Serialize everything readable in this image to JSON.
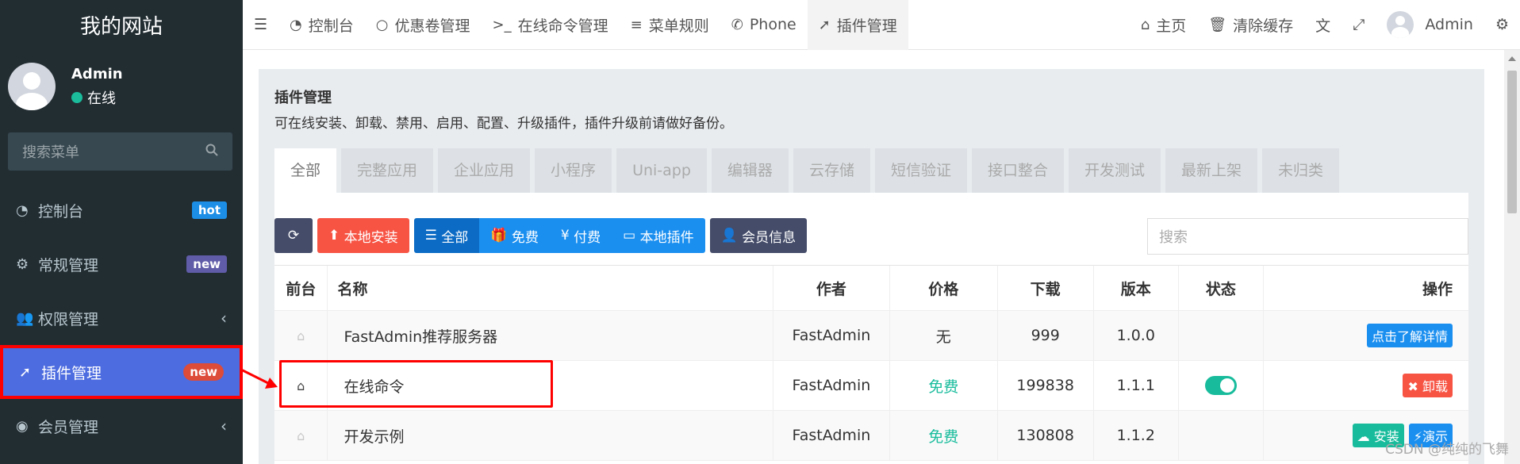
{
  "sidebar": {
    "site_title": "我的网站",
    "user_name": "Admin",
    "user_status": "在线",
    "search_placeholder": "搜索菜单",
    "items": [
      {
        "label": "控制台",
        "badge": "hot",
        "icon": "dashboard-icon"
      },
      {
        "label": "常规管理",
        "badge": "new",
        "icon": "cogs-icon"
      },
      {
        "label": "权限管理",
        "icon": "users-icon"
      },
      {
        "label": "插件管理",
        "badge": "new",
        "icon": "rocket-icon"
      },
      {
        "label": "会员管理",
        "icon": "user-circle-icon"
      }
    ]
  },
  "topbar": {
    "tabs": [
      {
        "label": "控制台",
        "icon": "dashboard-icon"
      },
      {
        "label": "优惠卷管理",
        "icon": "circle-icon"
      },
      {
        "label": "在线命令管理",
        "icon": "terminal-icon"
      },
      {
        "label": "菜单规则",
        "icon": "list-icon"
      },
      {
        "label": "Phone",
        "icon": "phone-icon"
      },
      {
        "label": "插件管理",
        "icon": "rocket-icon"
      }
    ],
    "home_label": "主页",
    "clear_cache_label": "清除缓存",
    "user_label": "Admin"
  },
  "panel": {
    "title": "插件管理",
    "description": "可在线安装、卸载、禁用、启用、配置、升级插件，插件升级前请做好备份。",
    "category_tabs": [
      "全部",
      "完整应用",
      "企业应用",
      "小程序",
      "Uni-app",
      "编辑器",
      "云存储",
      "短信验证",
      "接口整合",
      "开发测试",
      "最新上架",
      "未归类"
    ]
  },
  "toolbar": {
    "local_install": "本地安装",
    "filter_all": "全部",
    "filter_free": "免费",
    "filter_paid": "付费",
    "filter_local": "本地插件",
    "member_info": "会员信息",
    "search_placeholder": "搜索"
  },
  "table": {
    "headers": [
      "前台",
      "名称",
      "作者",
      "价格",
      "下载",
      "版本",
      "状态",
      "操作"
    ],
    "rows": [
      {
        "name": "FastAdmin推荐服务器",
        "author": "FastAdmin",
        "price": "无",
        "downloads": "999",
        "version": "1.0.0",
        "action": "点击了解详情"
      },
      {
        "name": "在线命令",
        "author": "FastAdmin",
        "price": "免费",
        "downloads": "199838",
        "version": "1.1.1",
        "enabled": true,
        "action": "卸载"
      },
      {
        "name": "开发示例",
        "author": "FastAdmin",
        "price": "免费",
        "downloads": "130808",
        "version": "1.1.2",
        "action": "安装",
        "action2": "演示"
      }
    ]
  },
  "watermark": "CSDN @纯纯的飞舞"
}
